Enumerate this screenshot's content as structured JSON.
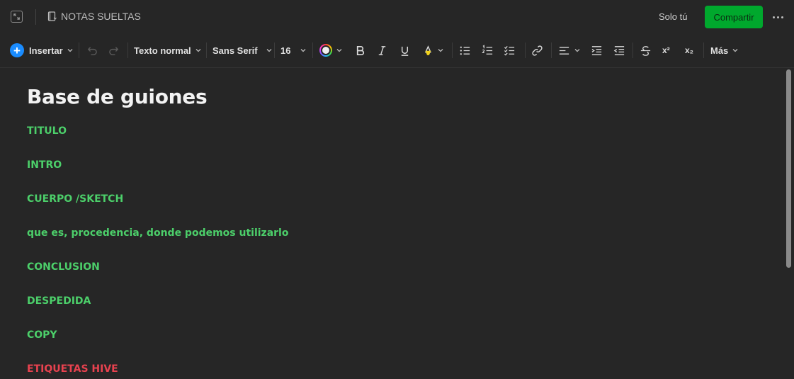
{
  "topbar": {
    "notebook_name": "NOTAS SUELTAS",
    "share_scope": "Solo tú",
    "share_button": "Compartir"
  },
  "toolbar": {
    "insert_label": "Insertar",
    "style_label": "Texto normal",
    "font_label": "Sans Serif",
    "size_label": "16",
    "superscript_label": "x²",
    "subscript_label": "x₂",
    "more_label": "Más"
  },
  "note": {
    "title": "Base de guiones",
    "lines": [
      {
        "text": "TITULO",
        "color": "#4ccf6a"
      },
      {
        "text": "INTRO",
        "color": "#4ccf6a"
      },
      {
        "text": "CUERPO /SKETCH",
        "color": "#4ccf6a"
      },
      {
        "text": "que es, procedencia, donde podemos utilizarlo",
        "color": "#4ccf6a"
      },
      {
        "text": "CONCLUSION",
        "color": "#4ccf6a"
      },
      {
        "text": "DESPEDIDA",
        "color": "#4ccf6a"
      },
      {
        "text": "COPY",
        "color": "#4ccf6a"
      },
      {
        "text": "ETIQUETAS HIVE",
        "color": "#e8424f"
      }
    ]
  },
  "colors": {
    "accent_share": "#00a82d",
    "insert_blue": "#1a8cff",
    "text_green": "#4ccf6a",
    "text_red": "#e8424f"
  }
}
